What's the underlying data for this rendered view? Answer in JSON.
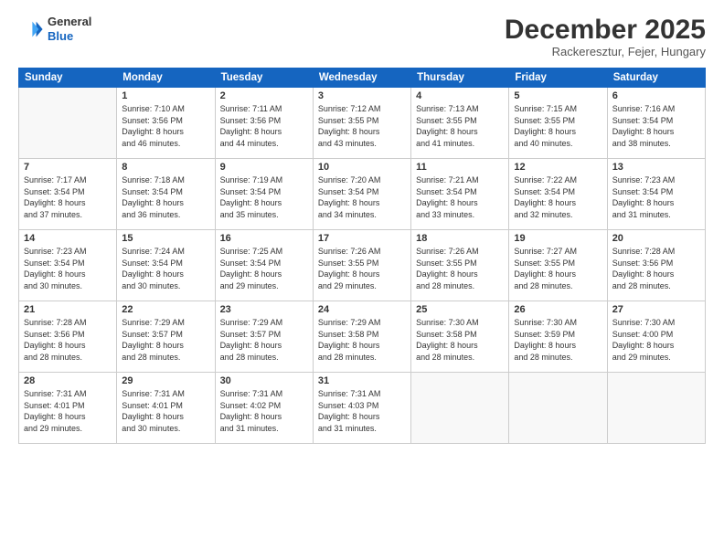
{
  "logo": {
    "general": "General",
    "blue": "Blue"
  },
  "header": {
    "month": "December 2025",
    "location": "Rackeresztur, Fejer, Hungary"
  },
  "weekdays": [
    "Sunday",
    "Monday",
    "Tuesday",
    "Wednesday",
    "Thursday",
    "Friday",
    "Saturday"
  ],
  "weeks": [
    [
      {
        "day": "",
        "info": ""
      },
      {
        "day": "1",
        "info": "Sunrise: 7:10 AM\nSunset: 3:56 PM\nDaylight: 8 hours\nand 46 minutes."
      },
      {
        "day": "2",
        "info": "Sunrise: 7:11 AM\nSunset: 3:56 PM\nDaylight: 8 hours\nand 44 minutes."
      },
      {
        "day": "3",
        "info": "Sunrise: 7:12 AM\nSunset: 3:55 PM\nDaylight: 8 hours\nand 43 minutes."
      },
      {
        "day": "4",
        "info": "Sunrise: 7:13 AM\nSunset: 3:55 PM\nDaylight: 8 hours\nand 41 minutes."
      },
      {
        "day": "5",
        "info": "Sunrise: 7:15 AM\nSunset: 3:55 PM\nDaylight: 8 hours\nand 40 minutes."
      },
      {
        "day": "6",
        "info": "Sunrise: 7:16 AM\nSunset: 3:54 PM\nDaylight: 8 hours\nand 38 minutes."
      }
    ],
    [
      {
        "day": "7",
        "info": "Sunrise: 7:17 AM\nSunset: 3:54 PM\nDaylight: 8 hours\nand 37 minutes."
      },
      {
        "day": "8",
        "info": "Sunrise: 7:18 AM\nSunset: 3:54 PM\nDaylight: 8 hours\nand 36 minutes."
      },
      {
        "day": "9",
        "info": "Sunrise: 7:19 AM\nSunset: 3:54 PM\nDaylight: 8 hours\nand 35 minutes."
      },
      {
        "day": "10",
        "info": "Sunrise: 7:20 AM\nSunset: 3:54 PM\nDaylight: 8 hours\nand 34 minutes."
      },
      {
        "day": "11",
        "info": "Sunrise: 7:21 AM\nSunset: 3:54 PM\nDaylight: 8 hours\nand 33 minutes."
      },
      {
        "day": "12",
        "info": "Sunrise: 7:22 AM\nSunset: 3:54 PM\nDaylight: 8 hours\nand 32 minutes."
      },
      {
        "day": "13",
        "info": "Sunrise: 7:23 AM\nSunset: 3:54 PM\nDaylight: 8 hours\nand 31 minutes."
      }
    ],
    [
      {
        "day": "14",
        "info": "Sunrise: 7:23 AM\nSunset: 3:54 PM\nDaylight: 8 hours\nand 30 minutes."
      },
      {
        "day": "15",
        "info": "Sunrise: 7:24 AM\nSunset: 3:54 PM\nDaylight: 8 hours\nand 30 minutes."
      },
      {
        "day": "16",
        "info": "Sunrise: 7:25 AM\nSunset: 3:54 PM\nDaylight: 8 hours\nand 29 minutes."
      },
      {
        "day": "17",
        "info": "Sunrise: 7:26 AM\nSunset: 3:55 PM\nDaylight: 8 hours\nand 29 minutes."
      },
      {
        "day": "18",
        "info": "Sunrise: 7:26 AM\nSunset: 3:55 PM\nDaylight: 8 hours\nand 28 minutes."
      },
      {
        "day": "19",
        "info": "Sunrise: 7:27 AM\nSunset: 3:55 PM\nDaylight: 8 hours\nand 28 minutes."
      },
      {
        "day": "20",
        "info": "Sunrise: 7:28 AM\nSunset: 3:56 PM\nDaylight: 8 hours\nand 28 minutes."
      }
    ],
    [
      {
        "day": "21",
        "info": "Sunrise: 7:28 AM\nSunset: 3:56 PM\nDaylight: 8 hours\nand 28 minutes."
      },
      {
        "day": "22",
        "info": "Sunrise: 7:29 AM\nSunset: 3:57 PM\nDaylight: 8 hours\nand 28 minutes."
      },
      {
        "day": "23",
        "info": "Sunrise: 7:29 AM\nSunset: 3:57 PM\nDaylight: 8 hours\nand 28 minutes."
      },
      {
        "day": "24",
        "info": "Sunrise: 7:29 AM\nSunset: 3:58 PM\nDaylight: 8 hours\nand 28 minutes."
      },
      {
        "day": "25",
        "info": "Sunrise: 7:30 AM\nSunset: 3:58 PM\nDaylight: 8 hours\nand 28 minutes."
      },
      {
        "day": "26",
        "info": "Sunrise: 7:30 AM\nSunset: 3:59 PM\nDaylight: 8 hours\nand 28 minutes."
      },
      {
        "day": "27",
        "info": "Sunrise: 7:30 AM\nSunset: 4:00 PM\nDaylight: 8 hours\nand 29 minutes."
      }
    ],
    [
      {
        "day": "28",
        "info": "Sunrise: 7:31 AM\nSunset: 4:01 PM\nDaylight: 8 hours\nand 29 minutes."
      },
      {
        "day": "29",
        "info": "Sunrise: 7:31 AM\nSunset: 4:01 PM\nDaylight: 8 hours\nand 30 minutes."
      },
      {
        "day": "30",
        "info": "Sunrise: 7:31 AM\nSunset: 4:02 PM\nDaylight: 8 hours\nand 31 minutes."
      },
      {
        "day": "31",
        "info": "Sunrise: 7:31 AM\nSunset: 4:03 PM\nDaylight: 8 hours\nand 31 minutes."
      },
      {
        "day": "",
        "info": ""
      },
      {
        "day": "",
        "info": ""
      },
      {
        "day": "",
        "info": ""
      }
    ]
  ]
}
